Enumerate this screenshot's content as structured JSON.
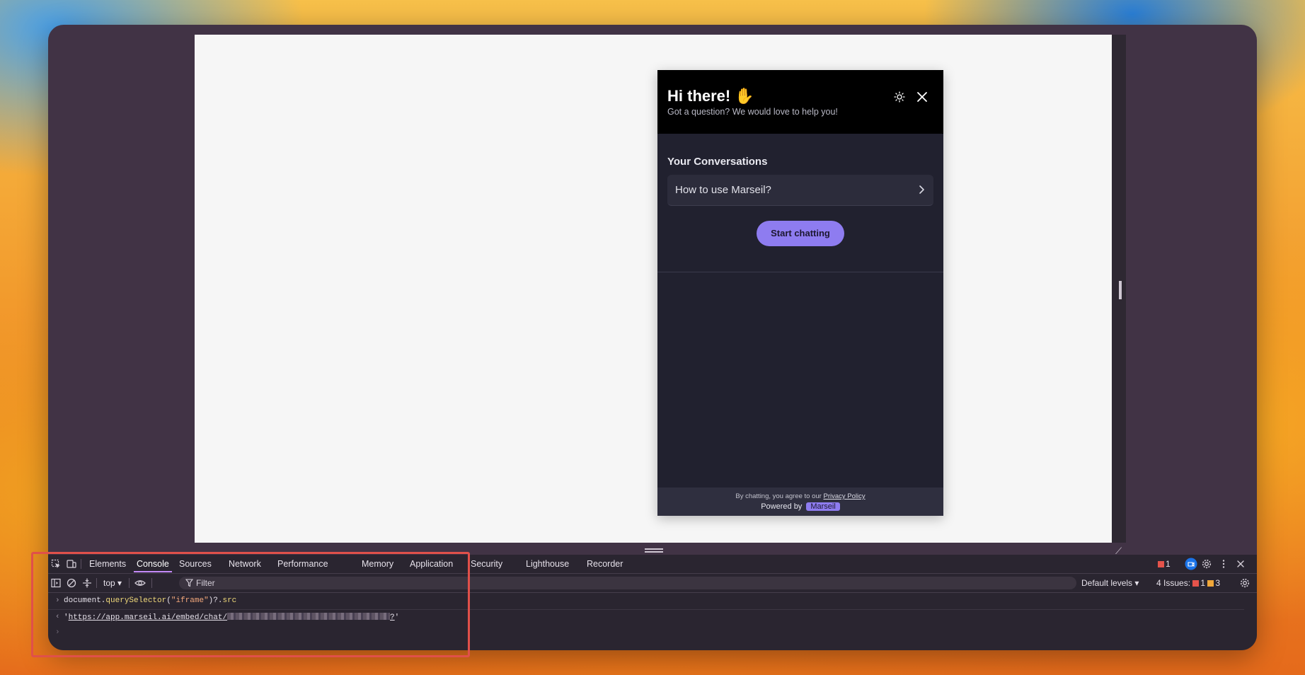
{
  "widget": {
    "title": "Hi there! ✋",
    "subtitle": "Got a question? We would love to help you!",
    "conversations_heading": "Your Conversations",
    "conversation_item": "How to use Marseil?",
    "start_button": "Start chatting",
    "agree_text": "By chatting, you agree to our",
    "privacy_link": "Privacy Policy",
    "powered_by": "Powered by",
    "brand": "Marseil",
    "accent_color": "#8e7cf0"
  },
  "devtools": {
    "tabs": [
      "Elements",
      "Console",
      "Sources",
      "Network",
      "Performance",
      "Memory",
      "Application",
      "Security",
      "Lighthouse",
      "Recorder"
    ],
    "active_tab": "Console",
    "error_count": "1",
    "context": "top ▾",
    "filter_placeholder": "Filter",
    "levels": "Default levels ▾",
    "issues_label": "4 Issues:",
    "issues_errors": "1",
    "issues_warnings": "3",
    "console": {
      "input_prefix": "document.",
      "input_fn": "querySelector",
      "input_open": "(",
      "input_arg": "\"iframe\"",
      "input_close": ")?.",
      "input_prop": "src",
      "output_quote_open": "'",
      "output_url": "https://app.marseil.ai/embed/chat/",
      "output_url_tail": "?",
      "output_quote_close": "'"
    }
  }
}
